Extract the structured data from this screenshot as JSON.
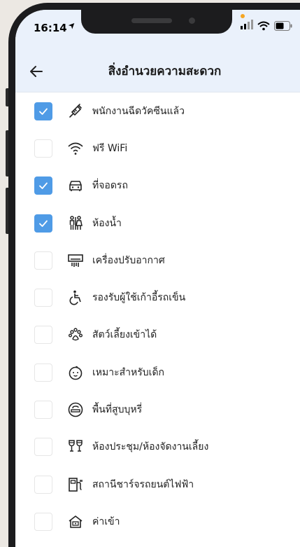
{
  "status_bar": {
    "time": "16:14"
  },
  "header": {
    "title": "สิ่งอำนวยความสะดวก"
  },
  "items": [
    {
      "label": "พนักงานฉีดวัคซีนแล้ว",
      "checked": true,
      "icon": "syringe-icon"
    },
    {
      "label": "ฟรี WiFi",
      "checked": false,
      "icon": "wifi-icon"
    },
    {
      "label": "ที่จอดรถ",
      "checked": true,
      "icon": "car-icon"
    },
    {
      "label": "ห้องน้ำ",
      "checked": true,
      "icon": "restroom-icon"
    },
    {
      "label": "เครื่องปรับอากาศ",
      "checked": false,
      "icon": "air-conditioner-icon"
    },
    {
      "label": "รองรับผู้ใช้เก้าอี้รถเข็น",
      "checked": false,
      "icon": "wheelchair-icon"
    },
    {
      "label": "สัตว์เลี้ยงเข้าได้",
      "checked": false,
      "icon": "paw-icon"
    },
    {
      "label": "เหมาะสำหรับเด็ก",
      "checked": false,
      "icon": "baby-face-icon"
    },
    {
      "label": "พื้นที่สูบบุหรี่",
      "checked": false,
      "icon": "smoking-area-icon"
    },
    {
      "label": "ห้องประชุม/ห้องจัดงานเลี้ยง",
      "checked": false,
      "icon": "wine-glasses-icon"
    },
    {
      "label": "สถานีชาร์จรถยนต์ไฟฟ้า",
      "checked": false,
      "icon": "ev-charger-icon"
    },
    {
      "label": "ค่าเข้า",
      "checked": false,
      "icon": "entrance-fee-icon"
    }
  ],
  "colors": {
    "accent": "#4f9be6",
    "header_bg": "#eaf1fb"
  }
}
